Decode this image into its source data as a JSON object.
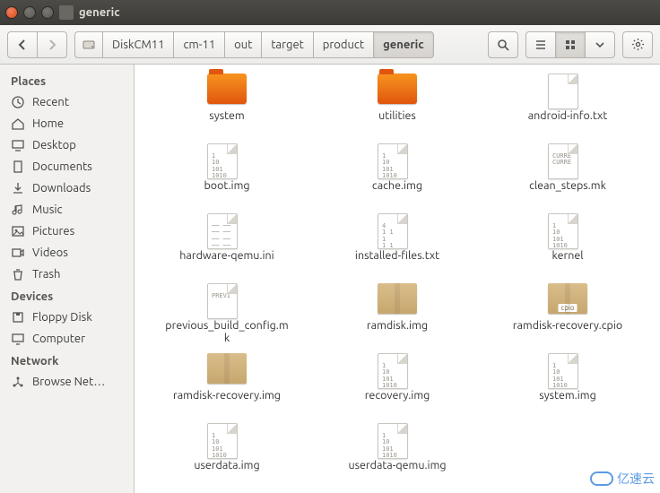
{
  "window": {
    "title": "generic"
  },
  "breadcrumbs": [
    {
      "label": "DiskCM11"
    },
    {
      "label": "cm-11"
    },
    {
      "label": "out"
    },
    {
      "label": "target"
    },
    {
      "label": "product"
    },
    {
      "label": "generic",
      "active": true
    }
  ],
  "sidebar": {
    "sections": [
      {
        "heading": "Places",
        "items": [
          {
            "label": "Recent",
            "icon": "clock"
          },
          {
            "label": "Home",
            "icon": "home"
          },
          {
            "label": "Desktop",
            "icon": "desktop"
          },
          {
            "label": "Documents",
            "icon": "doc"
          },
          {
            "label": "Downloads",
            "icon": "download"
          },
          {
            "label": "Music",
            "icon": "music"
          },
          {
            "label": "Pictures",
            "icon": "picture"
          },
          {
            "label": "Videos",
            "icon": "video"
          },
          {
            "label": "Trash",
            "icon": "trash"
          }
        ]
      },
      {
        "heading": "Devices",
        "items": [
          {
            "label": "Floppy Disk",
            "icon": "floppy"
          },
          {
            "label": "Computer",
            "icon": "computer"
          }
        ]
      },
      {
        "heading": "Network",
        "items": [
          {
            "label": "Browse Net…",
            "icon": "network"
          }
        ]
      }
    ]
  },
  "files": [
    {
      "name": "system",
      "type": "folder"
    },
    {
      "name": "utilities",
      "type": "folder"
    },
    {
      "name": "android-info.txt",
      "type": "doc-plain"
    },
    {
      "name": "boot.img",
      "type": "doc-bin"
    },
    {
      "name": "cache.img",
      "type": "doc-bin"
    },
    {
      "name": "clean_steps.mk",
      "type": "doc-mk"
    },
    {
      "name": "hardware-qemu.ini",
      "type": "doc-text"
    },
    {
      "name": "installed-files.txt",
      "type": "doc-list"
    },
    {
      "name": "kernel",
      "type": "doc-bin"
    },
    {
      "name": "previous_build_config.mk",
      "type": "doc-prev"
    },
    {
      "name": "ramdisk.img",
      "type": "box"
    },
    {
      "name": "ramdisk-recovery.cpio",
      "type": "box-cpio"
    },
    {
      "name": "ramdisk-recovery.img",
      "type": "box"
    },
    {
      "name": "recovery.img",
      "type": "doc-bin"
    },
    {
      "name": "system.img",
      "type": "doc-bin"
    },
    {
      "name": "userdata.img",
      "type": "doc-bin"
    },
    {
      "name": "userdata-qemu.img",
      "type": "doc-bin"
    }
  ],
  "watermark": "亿速云"
}
